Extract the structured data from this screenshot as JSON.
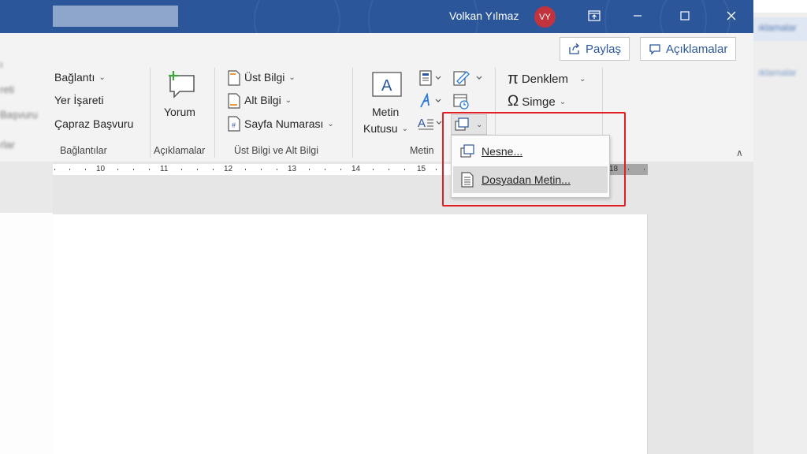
{
  "titlebar": {
    "user_name": "Volkan Yılmaz",
    "avatar_initials": "VY",
    "bg_color": "#2b579a",
    "avatar_color": "#c2343d"
  },
  "actions": {
    "share_label": "Paylaş",
    "comments_label": "Açıklamalar"
  },
  "ribbon": {
    "links": {
      "items": [
        "Bağlantı",
        "Yer İşareti",
        "Çapraz Başvuru"
      ],
      "group_label": "Bağlantılar"
    },
    "comments": {
      "button_label": "Yorum",
      "group_label": "Açıklamalar"
    },
    "header_footer": {
      "items": [
        "Üst Bilgi",
        "Alt Bilgi",
        "Sayfa Numarası"
      ],
      "group_label": "Üst Bilgi ve Alt Bilgi"
    },
    "text": {
      "textbox_line1": "Metin",
      "textbox_line2": "Kutusu",
      "group_label": "Metin"
    },
    "symbols": {
      "items": [
        "Denklem",
        "Simge"
      ]
    }
  },
  "dropdown": {
    "items": [
      {
        "label": "Nesne...",
        "icon": "object-icon"
      },
      {
        "label": "Dosyadan Metin...",
        "icon": "text-from-file-icon"
      }
    ],
    "hovered_index": 1
  },
  "ruler": {
    "numbers": [
      "10",
      "11",
      "12",
      "13",
      "14",
      "15",
      "18"
    ]
  },
  "background_left": {
    "lines": [
      "ı",
      "reti",
      "Başvuru",
      "rlar"
    ]
  },
  "background_right": {
    "lines": [
      "ıklamalar",
      "ıklamalar"
    ]
  },
  "highlight_color": "#e01f25"
}
